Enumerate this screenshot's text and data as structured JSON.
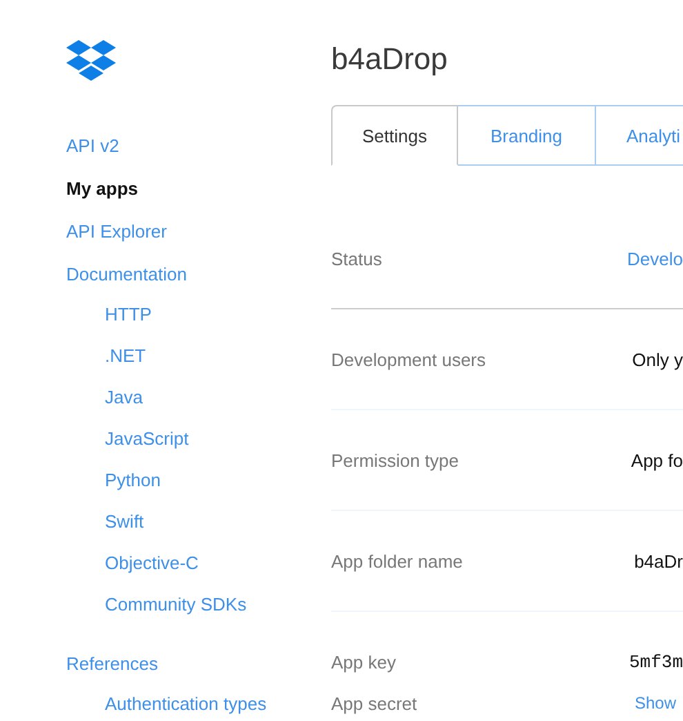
{
  "sidebar": {
    "items": [
      {
        "label": "API v2",
        "selected": false
      },
      {
        "label": "My apps",
        "selected": true
      },
      {
        "label": "API Explorer",
        "selected": false
      },
      {
        "label": "Documentation",
        "selected": false,
        "children": [
          {
            "label": "HTTP",
            "selected": false
          },
          {
            "label": ".NET",
            "selected": false
          },
          {
            "label": "Java",
            "selected": false
          },
          {
            "label": "JavaScript",
            "selected": false
          },
          {
            "label": "Python",
            "selected": false
          },
          {
            "label": "Swift",
            "selected": false
          },
          {
            "label": "Objective-C",
            "selected": false
          },
          {
            "label": "Community SDKs",
            "selected": false
          }
        ]
      },
      {
        "label": "References",
        "selected": false,
        "children": [
          {
            "label": "Authentication types",
            "selected": false
          }
        ]
      }
    ]
  },
  "page": {
    "title": "b4aDrop"
  },
  "tabs": [
    {
      "label": "Settings",
      "selected": true
    },
    {
      "label": "Branding",
      "selected": false
    },
    {
      "label": "Analyti",
      "selected": false
    }
  ],
  "settings": {
    "rows": [
      {
        "label": "Status",
        "value": "Develo",
        "kind": "link"
      },
      {
        "label": "Development users",
        "value": "Only y",
        "kind": "text"
      },
      {
        "label": "Permission type",
        "value": "App fo",
        "kind": "text"
      },
      {
        "label": "App folder name",
        "value": "b4aDr",
        "kind": "text"
      }
    ],
    "keys": [
      {
        "label": "App key",
        "value": "5mf3m",
        "kind": "mono"
      },
      {
        "label": "App secret",
        "value": "Show",
        "kind": "action"
      }
    ]
  }
}
